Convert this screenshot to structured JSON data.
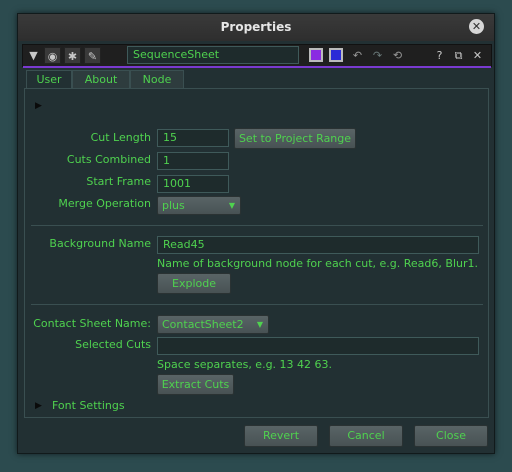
{
  "window": {
    "title": "Properties"
  },
  "toolbar": {
    "node_name": "SequenceSheet",
    "icons": [
      "collapse-triangle-icon",
      "center-node-icon",
      "bug-icon",
      "wrench-icon"
    ],
    "swatch_colors": [
      "#8a2be2",
      "#2a2ad6"
    ]
  },
  "tabs": [
    "User",
    "About",
    "Node"
  ],
  "form": {
    "cut_length_label": "Cut Length",
    "cut_length_value": "15",
    "set_range_button": "Set to Project Range",
    "cuts_combined_label": "Cuts Combined",
    "cuts_combined_value": "1",
    "start_frame_label": "Start Frame",
    "start_frame_value": "1001",
    "merge_op_label": "Merge Operation",
    "merge_op_value": "plus",
    "background_name_label": "Background Name",
    "background_name_value": "Read45",
    "background_note": "Name of background node for each cut, e.g. Read6, Blur1.",
    "explode_button": "Explode",
    "contact_sheet_label": "Contact Sheet Name:",
    "contact_sheet_value": "ContactSheet2",
    "selected_cuts_label": "Selected Cuts",
    "selected_cuts_value": "",
    "selected_cuts_note": "Space separates, e.g. 13 42 63.",
    "extract_cuts_button": "Extract Cuts",
    "font_settings_label": "Font Settings"
  },
  "footer": {
    "revert": "Revert",
    "cancel": "Cancel",
    "close": "Close"
  },
  "colors": {
    "text_green": "#4fd24f",
    "accent_purple": "#7a3ad0"
  }
}
